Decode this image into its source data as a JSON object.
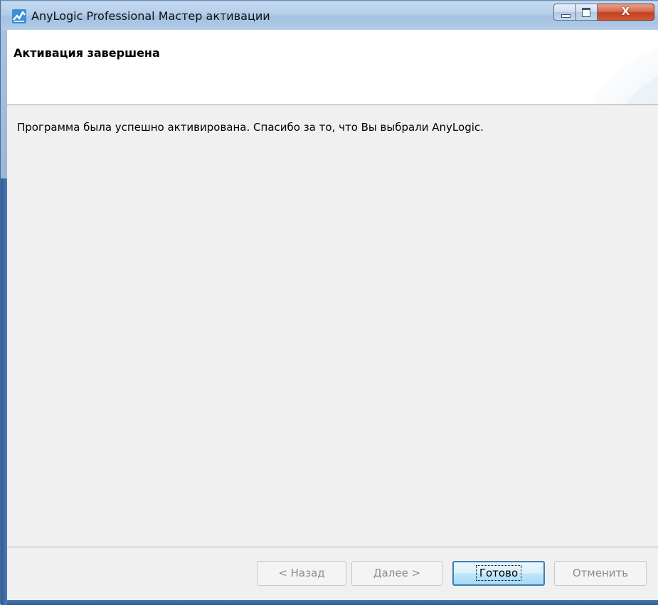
{
  "window": {
    "title": "AnyLogic Professional Мастер активации",
    "close_glyph": "X",
    "icons": {
      "app": "anylogic-logo-icon",
      "minimize": "minimize-icon",
      "maximize": "maximize-icon",
      "close": "close-icon"
    }
  },
  "header": {
    "title": "Активация завершена"
  },
  "content": {
    "message": "Программа была успешно активирована. Спасибо за то, что Вы выбрали AnyLogic."
  },
  "buttons": {
    "back": {
      "label": "< Назад",
      "enabled": false
    },
    "next": {
      "label": "Далее >",
      "enabled": false
    },
    "finish": {
      "label": "Готово",
      "enabled": true,
      "default": true
    },
    "cancel": {
      "label": "Отменить",
      "enabled": false
    }
  },
  "colors": {
    "frame": "#94b3d6",
    "client_bg": "#f0f0f0",
    "default_button_border": "#3c7fb1"
  }
}
